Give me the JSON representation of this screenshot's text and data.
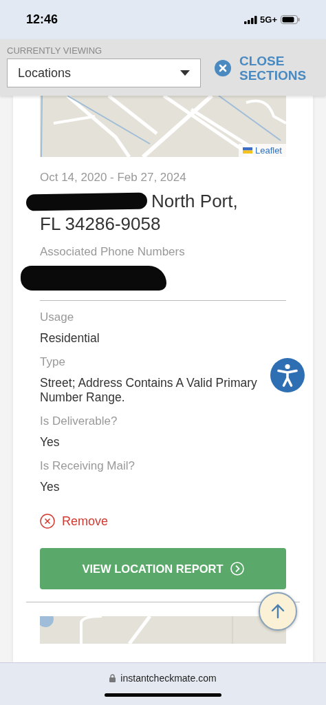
{
  "status_bar": {
    "time": "12:46",
    "network": "5G+"
  },
  "header": {
    "label": "CURRENTLY VIEWING",
    "dropdown": {
      "value": "Locations"
    },
    "close_button": "CLOSE SECTIONS"
  },
  "location": {
    "map": {
      "attribution": "Leaflet"
    },
    "date_range": "Oct 14, 2020 - Feb 27, 2024",
    "address_lines": [
      "North Port,",
      "FL 34286-9058"
    ],
    "phone_label": "Associated Phone Numbers",
    "fields": [
      {
        "label": "Usage",
        "value": "Residential"
      },
      {
        "label": "Type",
        "value": "Street; Address Contains A Valid Primary Number Range."
      },
      {
        "label": "Is Deliverable?",
        "value": "Yes"
      },
      {
        "label": "Is Receiving Mail?",
        "value": "Yes"
      }
    ],
    "remove_link": "Remove",
    "report_button": "VIEW LOCATION REPORT"
  },
  "browser": {
    "url": "instantcheckmate.com"
  }
}
